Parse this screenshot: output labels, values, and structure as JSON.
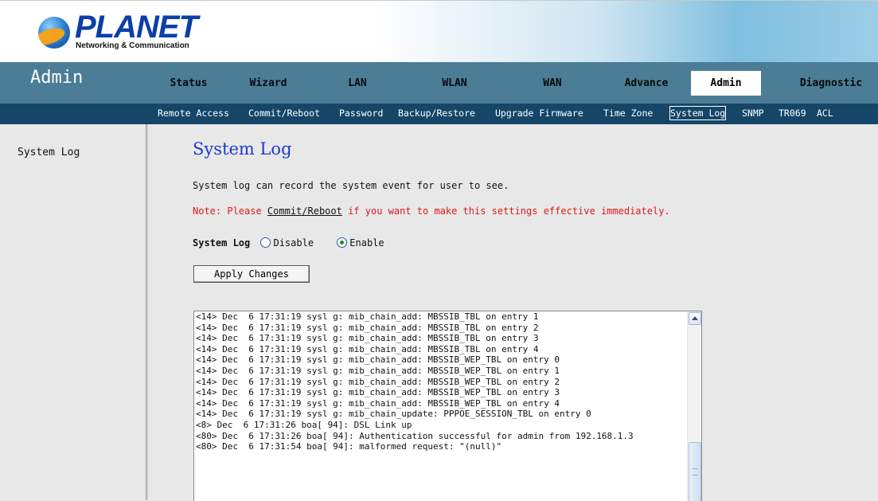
{
  "brand": {
    "name": "PLANET",
    "tagline": "Networking & Communication"
  },
  "nav": {
    "section_title": "Admin",
    "tabs": [
      {
        "label": "Status"
      },
      {
        "label": "Wizard"
      },
      {
        "label": "LAN"
      },
      {
        "label": "WLAN"
      },
      {
        "label": "WAN"
      },
      {
        "label": "Advance"
      },
      {
        "label": "Admin"
      },
      {
        "label": "Diagnostic"
      }
    ],
    "active_tab": "Admin"
  },
  "subnav": {
    "items": [
      {
        "label": "Remote Access"
      },
      {
        "label": "Commit/Reboot"
      },
      {
        "label": "Password"
      },
      {
        "label": "Backup/Restore"
      },
      {
        "label": "Upgrade Firmware"
      },
      {
        "label": "Time Zone"
      },
      {
        "label": "System Log"
      },
      {
        "label": "SNMP"
      },
      {
        "label": "TR069"
      },
      {
        "label": "ACL"
      }
    ],
    "active_item": "System Log"
  },
  "sidebar": {
    "items": [
      {
        "label": "System Log"
      }
    ]
  },
  "main": {
    "title": "System Log",
    "description": "System log can record the system event for user to see.",
    "note_prefix": "Note: Please ",
    "note_link": "Commit/Reboot",
    "note_suffix": " if you want to make this settings effective immediately.",
    "system_log_label": "System Log",
    "options": [
      {
        "label": "Disable",
        "checked": false
      },
      {
        "label": "Enable",
        "checked": true
      }
    ],
    "apply_button": "Apply Changes",
    "log_lines": [
      "<14> Dec  6 17:31:19 sysl g: mib_chain_add: MBSSIB_TBL on entry 1",
      "<14> Dec  6 17:31:19 sysl g: mib_chain_add: MBSSIB_TBL on entry 2",
      "<14> Dec  6 17:31:19 sysl g: mib_chain_add: MBSSIB_TBL on entry 3",
      "<14> Dec  6 17:31:19 sysl g: mib_chain_add: MBSSIB_TBL on entry 4",
      "<14> Dec  6 17:31:19 sysl g: mib_chain_add: MBSSIB_WEP_TBL on entry 0",
      "<14> Dec  6 17:31:19 sysl g: mib_chain_add: MBSSIB_WEP_TBL on entry 1",
      "<14> Dec  6 17:31:19 sysl g: mib_chain_add: MBSSIB_WEP_TBL on entry 2",
      "<14> Dec  6 17:31:19 sysl g: mib_chain_add: MBSSIB_WEP_TBL on entry 3",
      "<14> Dec  6 17:31:19 sysl g: mib_chain_add: MBSSIB_WEP_TBL on entry 4",
      "<14> Dec  6 17:31:19 sysl g: mib_chain_update: PPPOE_SESSION_TBL on entry 0",
      "<8> Dec  6 17:31:26 boa[ 94]: DSL Link up",
      "<80> Dec  6 17:31:26 boa[ 94]: Authentication successful for admin from 192.168.1.3",
      "<80> Dec  6 17:31:54 boa[ 94]: malformed request: \"(null)\""
    ]
  }
}
